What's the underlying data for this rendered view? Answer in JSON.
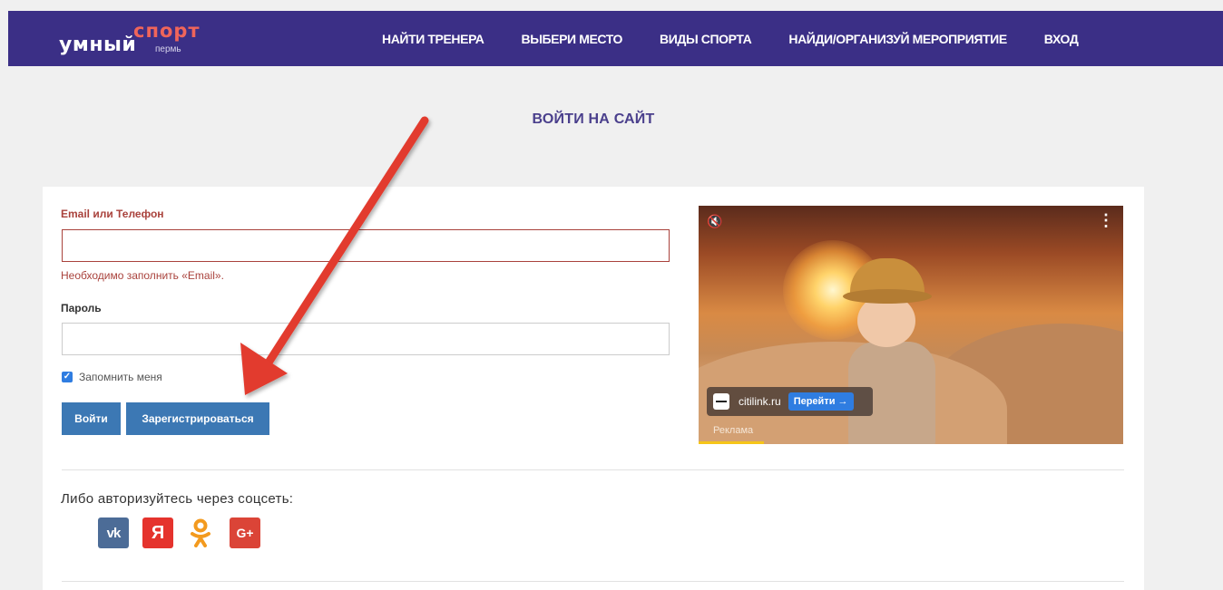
{
  "header": {
    "logo": {
      "word1": "умный",
      "word2": "спорт",
      "city": "пермь"
    },
    "nav": [
      "НАЙТИ ТРЕНЕРА",
      "ВЫБЕРИ МЕСТО",
      "ВИДЫ СПОРТА",
      "НАЙДИ/ОРГАНИЗУЙ МЕРОПРИЯТИЕ",
      "ВХОД"
    ]
  },
  "page": {
    "title": "ВОЙТИ НА САЙТ"
  },
  "form": {
    "email_label": "Email или Телефон",
    "email_value": "",
    "email_error": "Необходимо заполнить «Email».",
    "password_label": "Пароль",
    "password_value": "",
    "remember_label": "Запомнить меня",
    "remember_checked": true,
    "login_button": "Войти",
    "register_button": "Зарегистрироваться"
  },
  "social": {
    "prompt": "Либо авторизуйтесь через соцсеть:",
    "networks": [
      {
        "name": "vk",
        "glyph": "vk",
        "color": "#4c6c97"
      },
      {
        "name": "yandex",
        "glyph": "Я",
        "color": "#e5332d"
      },
      {
        "name": "odnoklassniki",
        "color": "#f39a1e"
      },
      {
        "name": "google-plus",
        "glyph": "G+",
        "color": "#db4437"
      }
    ]
  },
  "ad": {
    "site": "citilink.ru",
    "go_button": "Перейти →",
    "label": "Реклама"
  },
  "colors": {
    "header_bg": "#3b2f86",
    "error": "#a9423c",
    "button": "#3c78b4",
    "annotation_arrow": "#e23a2d"
  }
}
